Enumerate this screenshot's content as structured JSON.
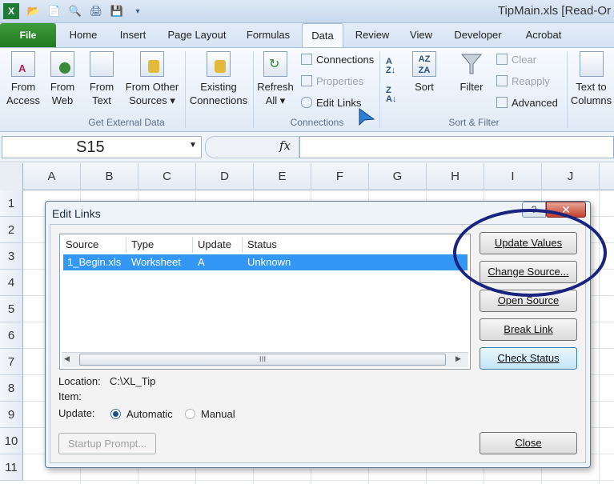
{
  "window": {
    "title": "TipMain.xls  [Read-Or"
  },
  "tabs": [
    "File",
    "Home",
    "Insert",
    "Page Layout",
    "Formulas",
    "Data",
    "Review",
    "View",
    "Developer",
    "Acrobat"
  ],
  "ribbon": {
    "get_external": {
      "label": "Get External Data",
      "buttons": [
        {
          "line1": "From",
          "line2": "Access"
        },
        {
          "line1": "From",
          "line2": "Web"
        },
        {
          "line1": "From",
          "line2": "Text"
        },
        {
          "line1": "From Other",
          "line2": "Sources ▾"
        },
        {
          "line1": "Existing",
          "line2": "Connections"
        }
      ]
    },
    "connections": {
      "label": "Connections",
      "refresh": {
        "line1": "Refresh",
        "line2": "All ▾"
      },
      "items": [
        "Connections",
        "Properties",
        "Edit Links"
      ]
    },
    "sort_filter": {
      "label": "Sort & Filter",
      "sort": "Sort",
      "filter": "Filter",
      "items": [
        "Clear",
        "Reapply",
        "Advanced"
      ]
    },
    "text_to_columns": {
      "line1": "Text to",
      "line2": "Columns"
    }
  },
  "formula_bar": {
    "name_box": "S15",
    "fx": "fx"
  },
  "columns": [
    "A",
    "B",
    "C",
    "D",
    "E",
    "F",
    "G",
    "H",
    "I",
    "J"
  ],
  "rows": [
    "1",
    "2",
    "3",
    "4",
    "5",
    "6",
    "7",
    "8",
    "9",
    "10",
    "11"
  ],
  "dialog": {
    "title": "Edit Links",
    "help": "?",
    "close": "✕",
    "list": {
      "headers": [
        "Source",
        "Type",
        "Update",
        "Status"
      ],
      "rows": [
        {
          "source": "1_Begin.xls",
          "type": "Worksheet",
          "update": "A",
          "status": "Unknown"
        }
      ]
    },
    "scroll_thumb": "III",
    "location_label": "Location:",
    "location_value": "C:\\XL_Tip",
    "item_label": "Item:",
    "update_label": "Update:",
    "radio_automatic": "Automatic",
    "radio_manual": "Manual",
    "buttons": {
      "update_values": "Update Values",
      "change_source": "Change Source...",
      "open_source": "Open Source",
      "break_link": "Break Link",
      "check_status": "Check Status",
      "startup_prompt": "Startup Prompt...",
      "close": "Close"
    }
  },
  "colors": {
    "accent": "#2a7a2a",
    "selection": "#3398f5",
    "annotation": "#1a237e"
  }
}
